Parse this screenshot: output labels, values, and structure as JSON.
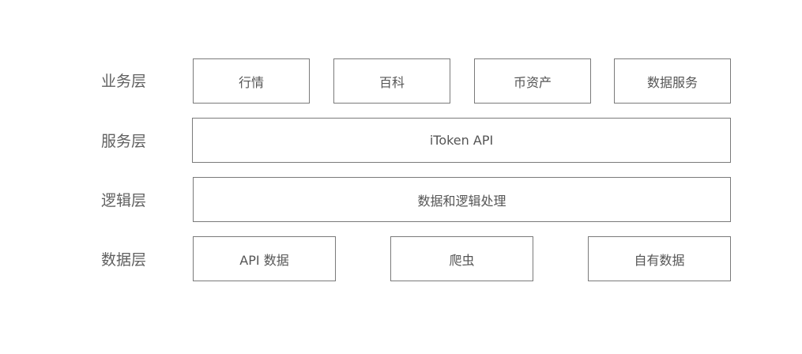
{
  "layers": [
    {
      "label": "业务层",
      "boxes": [
        "行情",
        "百科",
        "币资产",
        "数据服务"
      ]
    },
    {
      "label": "服务层",
      "boxes": [
        "iToken API"
      ]
    },
    {
      "label": "逻辑层",
      "boxes": [
        "数据和逻辑处理"
      ]
    },
    {
      "label": "数据层",
      "boxes": [
        "API 数据",
        "爬虫",
        "自有数据"
      ]
    }
  ],
  "colors": {
    "border": "#7a7a7a",
    "text": "#555555",
    "label": "#606060",
    "background": "#ffffff"
  }
}
